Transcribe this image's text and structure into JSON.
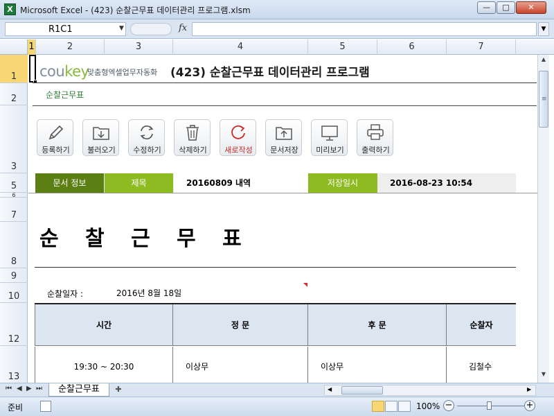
{
  "window": {
    "title": "Microsoft Excel - (423) 순찰근무표 데이터관리 프로그램.xlsm",
    "app_icon": "X",
    "minimize": "—",
    "maximize": "□",
    "close": "✕"
  },
  "formula_bar": {
    "name_box": "R1C1",
    "fx": "fx",
    "formula": ""
  },
  "columns": [
    "1",
    "2",
    "3",
    "4",
    "5",
    "6",
    "7"
  ],
  "rows": [
    "1",
    "2",
    "3",
    "5",
    "6",
    "7",
    "8",
    "9",
    "10",
    "12",
    "13"
  ],
  "header": {
    "logo_cou": "cou",
    "logo_key": "key",
    "tagline": "맞춤형엑셀업무자동화",
    "app_title": "(423) 순찰근무표 데이터관리 프로그램",
    "subtitle": "순찰근무표"
  },
  "toolbar": [
    {
      "label": "등록하기",
      "icon": "pencil-icon"
    },
    {
      "label": "불러오기",
      "icon": "folder-download-icon"
    },
    {
      "label": "수정하기",
      "icon": "refresh-icon"
    },
    {
      "label": "삭제하기",
      "icon": "trash-icon"
    },
    {
      "label": "새로작성",
      "icon": "new-cycle-icon"
    },
    {
      "label": "문서저장",
      "icon": "folder-upload-icon"
    },
    {
      "label": "미리보기",
      "icon": "monitor-icon"
    },
    {
      "label": "출력하기",
      "icon": "printer-icon"
    }
  ],
  "info": {
    "doc_info": "문서 정보",
    "title_label": "제목",
    "title_value": "20160809 내역",
    "date_label": "저장일시",
    "date_value": "2016-08-23 10:54"
  },
  "document": {
    "title": "순 찰 근 무 표",
    "patrol_date_label": "순찰일자 :",
    "patrol_date_value": "2016년 8월 18일"
  },
  "table": {
    "headers": [
      "시간",
      "정 문",
      "후 문",
      "순찰자"
    ],
    "rows": [
      [
        "19:30 ~ 20:30",
        "이상무",
        "이상무",
        "김철수"
      ]
    ]
  },
  "sheet_tabs": {
    "active": "순찰근무표"
  },
  "status": {
    "ready": "준비",
    "zoom": "100%",
    "zoom_minus": "−",
    "zoom_plus": "+"
  },
  "colors": {
    "accent_dark": "#5c7f14",
    "accent": "#8dbb21",
    "table_header": "#dce6f1",
    "selected_header": "#f6d774"
  }
}
